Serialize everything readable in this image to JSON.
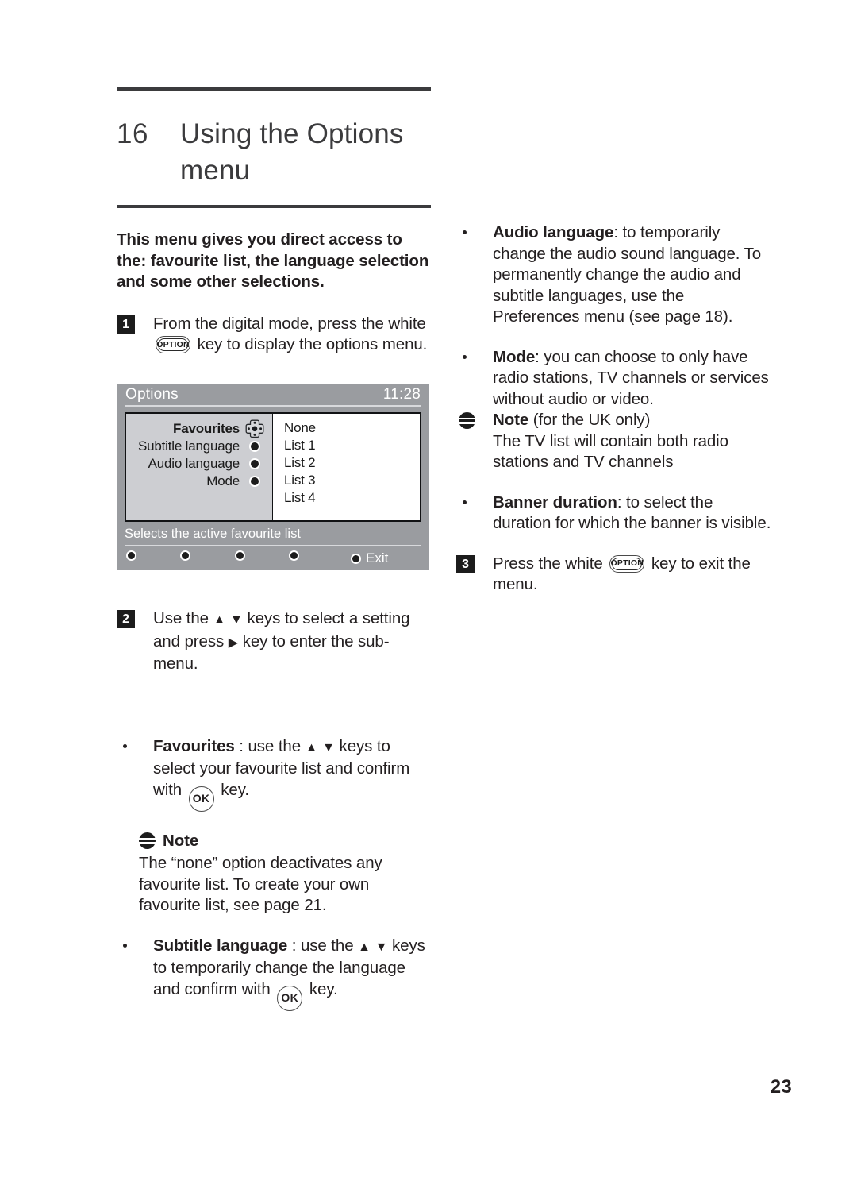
{
  "document": {
    "chapter_number": "16",
    "chapter_title": "Using the Options menu",
    "folio": "23"
  },
  "left_column": {
    "intro": "This menu gives you direct access to the: favourite list, the language selection and some other selections.",
    "step1": {
      "badge": "1",
      "text_before": "From the digital mode, press the white",
      "key_label": "OPTION",
      "text_after": "key to display the options menu."
    },
    "step2": {
      "badge": "2",
      "line1_a": "Use the",
      "line1_b": "keys to select a setting",
      "line2_a": "and press",
      "line2_b": "key to enter the sub-menu."
    },
    "bullet_favourites": {
      "term": "Favourites",
      "text_a": ": use the",
      "text_b": "keys to select",
      "text_c": "your favourite list and confirm with",
      "key_label": "OK",
      "text_d": "key."
    },
    "note": {
      "heading": "Note",
      "body": "The “none” option deactivates any favourite list. To create your own favourite list, see page 21."
    },
    "bullet_subtitle": {
      "term": "Subtitle language",
      "text_a": ": use the",
      "text_b": "keys",
      "text_c": "to temporarily change the language and",
      "text_d": "confirm with",
      "key_label": "OK",
      "text_e": "key."
    }
  },
  "right_column": {
    "bullet_audio": {
      "term": "Audio language",
      "text": ": to temporarily change the audio sound language. To permanently change the audio and subtitle languages, use the Preferences menu (see page 18)."
    },
    "bullet_mode": {
      "term": "Mode",
      "text": ": you can choose to only have radio stations, TV channels or services without audio or video."
    },
    "note_uk": {
      "heading": "Note",
      "heading_suffix": "(for the UK only)",
      "body": "The TV list will contain both radio stations and TV channels"
    },
    "bullet_banner": {
      "term": "Banner duration",
      "text": ": to select the duration for which the banner is visible."
    },
    "step3": {
      "badge": "3",
      "text_before": "Press the white",
      "key_label": "OPTION",
      "text_after": "key to exit the",
      "text_line2": "menu."
    }
  },
  "osd": {
    "title": "Options",
    "time": "11:28",
    "menu_items": [
      {
        "label": "Favourites",
        "selected": true
      },
      {
        "label": "Subtitle language",
        "selected": false
      },
      {
        "label": "Audio language",
        "selected": false
      },
      {
        "label": "Mode",
        "selected": false
      }
    ],
    "submenu_items": [
      "None",
      "List 1",
      "List 2",
      "List 3",
      "List 4"
    ],
    "help_text": "Selects the active favourite list",
    "exit_label": "Exit",
    "colors": {
      "background": "#9a9ca0",
      "panel": "#cdced2",
      "submenu": "#ffffff",
      "border": "#111214",
      "text_light": "#ffffff"
    }
  }
}
